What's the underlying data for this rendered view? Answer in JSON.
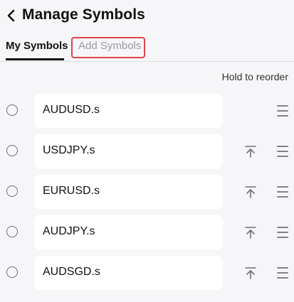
{
  "header": {
    "title": "Manage Symbols",
    "back_icon": "chevron-left-icon"
  },
  "tabs": [
    {
      "label": "My Symbols",
      "active": true
    },
    {
      "label": "Add Symbols",
      "active": false,
      "highlighted": true
    }
  ],
  "hint": "Hold to reorder",
  "symbols": [
    {
      "name": "AUDUSD.s",
      "pinned_to_top": true
    },
    {
      "name": "USDJPY.s",
      "pinned_to_top": false
    },
    {
      "name": "EURUSD.s",
      "pinned_to_top": false
    },
    {
      "name": "AUDJPY.s",
      "pinned_to_top": false
    },
    {
      "name": "AUDSGD.s",
      "pinned_to_top": false
    }
  ],
  "icons": {
    "pin": "move-to-top-icon",
    "drag": "drag-handle-icon",
    "select": "radio-circle-icon"
  },
  "colors": {
    "background": "#f6f6f8",
    "card": "#ffffff",
    "active_tab": "#111111",
    "inactive_tab": "#9a9aa0",
    "highlight_box": "#e0434b",
    "icon": "#6f6f76"
  }
}
